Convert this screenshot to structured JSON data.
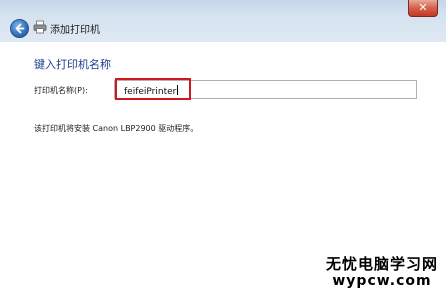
{
  "window": {
    "title": "添加打印机",
    "close_label": "✕"
  },
  "icons": {
    "back": "back-arrow-icon",
    "printer": "printer-icon"
  },
  "page": {
    "heading": "键入打印机名称",
    "name_label": "打印机名称(P):",
    "name_value": "feifeiPrinter",
    "driver_note": "该打印机将安装 Canon LBP2900 驱动程序。"
  },
  "watermark": {
    "site_name": "无忧电脑学习网",
    "site_url": "wypcw.com"
  },
  "colors": {
    "heading": "#1e3d8f",
    "highlight": "#d0181e",
    "close_button": "#c23a22"
  }
}
